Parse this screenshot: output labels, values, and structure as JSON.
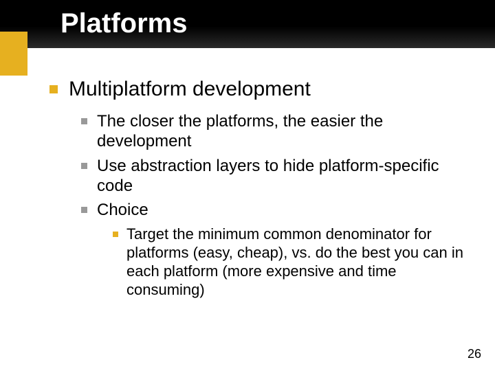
{
  "slide": {
    "title": "Platforms",
    "page_number": "26",
    "level1": {
      "text": "Multiplatform development"
    },
    "level2": [
      {
        "text": "The closer the platforms, the easier the development"
      },
      {
        "text": "Use abstraction layers to hide platform-specific code"
      },
      {
        "text": "Choice"
      }
    ],
    "level3": [
      {
        "text": "Target the minimum common denominator for platforms (easy, cheap), vs. do the best you can in each platform (more expensive and time consuming)"
      }
    ]
  }
}
